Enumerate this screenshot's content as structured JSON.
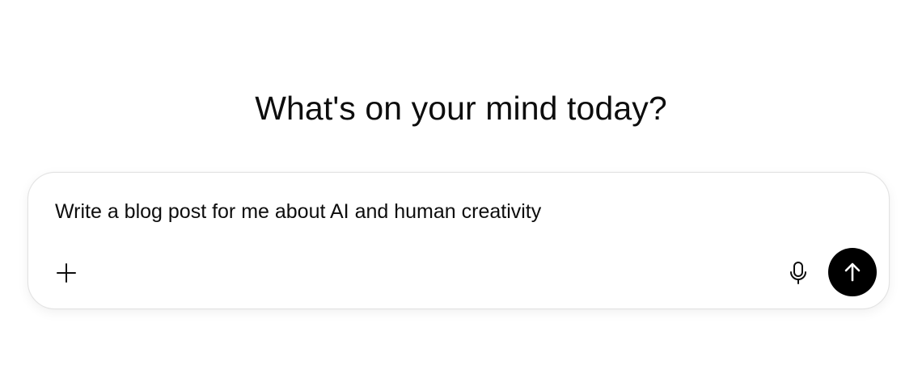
{
  "main": {
    "heading": "What's on your mind today?"
  },
  "composer": {
    "text": "Write a blog post for me about AI and human creativity",
    "icons": {
      "attach": "plus-icon",
      "voice": "microphone-icon",
      "send": "arrow-up-icon"
    }
  },
  "colors": {
    "send_button": "#000000",
    "text": "#0d0d0d",
    "border": "#e3e3e3"
  }
}
